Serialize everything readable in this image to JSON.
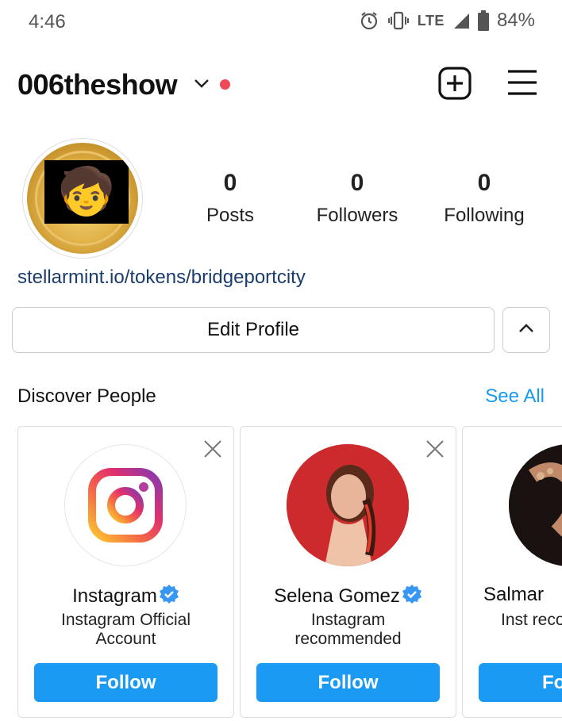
{
  "status_bar": {
    "time": "4:46",
    "network": "LTE",
    "battery": "84%",
    "icons": [
      "alarm-icon",
      "vibrate-icon",
      "signal-icon",
      "battery-icon"
    ]
  },
  "header": {
    "username": "006theshow",
    "icons": [
      "chevron-down-icon",
      "new-post-icon",
      "menu-icon"
    ],
    "live_dot_color": "#ed4956"
  },
  "profile": {
    "stats": [
      {
        "value": "0",
        "label": "Posts"
      },
      {
        "value": "0",
        "label": "Followers"
      },
      {
        "value": "0",
        "label": "Following"
      }
    ],
    "link": "stellarmint.io/tokens/bridgeportcity",
    "edit_label": "Edit Profile"
  },
  "discover": {
    "title": "Discover People",
    "see_all": "See All",
    "cards": [
      {
        "name": "Instagram",
        "verified": true,
        "subtitle": "Instagram Official Account",
        "button": "Follow"
      },
      {
        "name": "Selena Gomez",
        "verified": true,
        "subtitle": "Instagram recommended",
        "button": "Follow"
      },
      {
        "name": "Salmar",
        "verified": false,
        "subtitle": "Inst recom",
        "button": "Fo"
      }
    ]
  },
  "colors": {
    "accent_blue": "#1a9af3",
    "link_blue": "#1c3d6b",
    "verified_blue": "#3897f0"
  }
}
